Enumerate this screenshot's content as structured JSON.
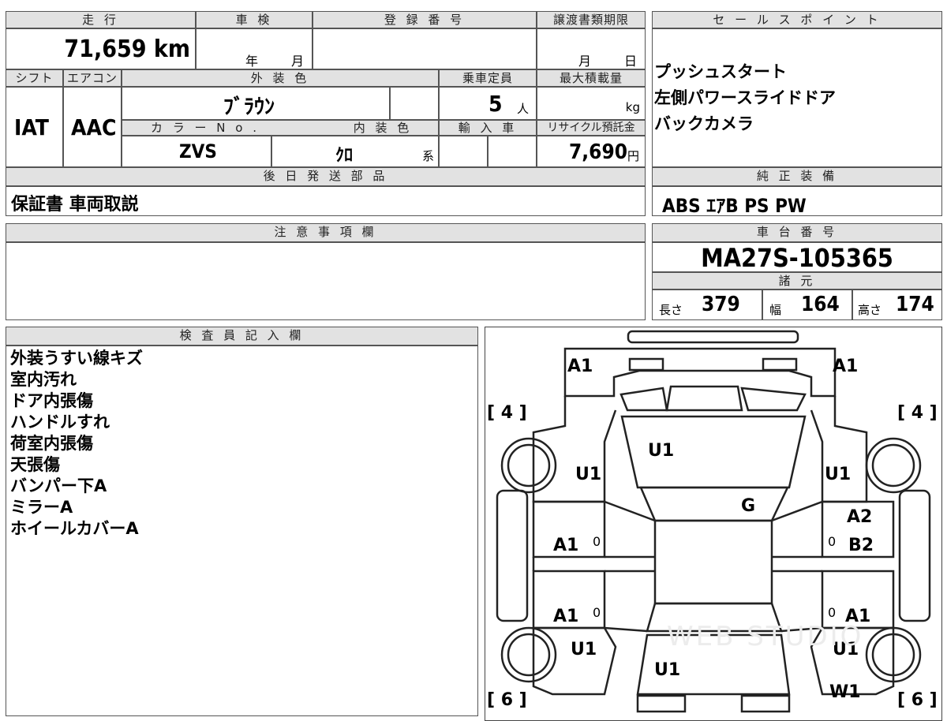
{
  "headers": {
    "mileage": "走 行",
    "inspection": "車 検",
    "registration": "登 録 番 号",
    "transfer_deadline": "譲渡書類期限",
    "sales_point": "セ ー ル ス ポ イ ン ト",
    "shift": "シフト",
    "aircon": "エアコン",
    "exterior_color": "外 装 色",
    "capacity": "乗車定員",
    "max_load": "最大積載量",
    "color_no": "カ ラ ー N o .",
    "interior_color": "内 装 色",
    "import": "輸 入 車",
    "recycle_fee": "リサイクル預託金",
    "later_parts": "後 日 発 送 部 品",
    "standard_equipment": "純 正 装 備",
    "notes": "注 意 事 項 欄",
    "chassis_no": "車 台 番 号",
    "specs": "諸 元",
    "inspector_notes": "検 査 員 記 入 欄"
  },
  "vehicle": {
    "mileage": "71,659 km",
    "inspection_year_unit": "年",
    "inspection_month_unit": "月",
    "deadline_month_unit": "月",
    "deadline_day_unit": "日",
    "shift": "IAT",
    "aircon": "AAC",
    "exterior_color": "ﾌﾞﾗｳﾝ",
    "capacity_value": "5",
    "capacity_unit": "人",
    "max_load_unit": "kg",
    "color_no": "ZVS",
    "interior_color": "ｸﾛ",
    "interior_color_suffix": "系",
    "recycle_fee_value": "7,690",
    "recycle_fee_unit": "円",
    "later_parts": "保証書 車両取説",
    "standard_equipment": "ABS ｴｱB PS PW",
    "chassis_no": "MA27S-105365",
    "length_label": "長さ",
    "length_value": "379",
    "width_label": "幅",
    "width_value": "164",
    "height_label": "高さ",
    "height_value": "174"
  },
  "sales_points": [
    "プッシュスタート",
    "左側パワースライドドア",
    "バックカメラ"
  ],
  "inspector_notes": [
    "外装うすい線キズ",
    "室内汚れ",
    "ドア内張傷",
    "ハンドルすれ",
    "荷室内張傷",
    "天張傷",
    "バンパー下A",
    "ミラーA",
    "ホイールカバーA"
  ],
  "diagram": {
    "labels": [
      "A1",
      "A1",
      "U1",
      "U1",
      "U1",
      "G",
      "A2",
      "B2",
      "A1",
      "A1",
      "A1",
      "U1",
      "U1",
      "U1",
      "W1"
    ],
    "tire_front_left": "[ 4 ]",
    "tire_front_right": "[ 4 ]",
    "tire_rear_left": "[ 6 ]",
    "tire_rear_right": "[ 6 ]",
    "zeros": [
      "0",
      "0",
      "0",
      "0"
    ],
    "watermark": "WEB STUDIO"
  }
}
